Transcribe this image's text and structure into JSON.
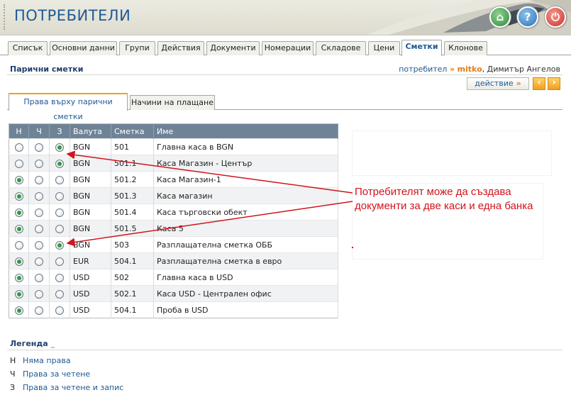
{
  "header": {
    "title": "ПОТРЕБИТЕЛИ"
  },
  "tabs": [
    {
      "label": "Списък"
    },
    {
      "label": "Основни данни"
    },
    {
      "label": "Групи"
    },
    {
      "label": "Действия"
    },
    {
      "label": "Документи"
    },
    {
      "label": "Номерации"
    },
    {
      "label": "Складове"
    },
    {
      "label": "Цени"
    },
    {
      "label": "Сметки",
      "active": true
    },
    {
      "label": "Клонове"
    }
  ],
  "section": {
    "title": "Парични сметки",
    "user_label": "потребител",
    "sep": "»",
    "username": "mitko",
    "fullname": ", Димитър Ангелов"
  },
  "actions": {
    "label": "действие",
    "arrow": "»",
    "prev": "‹",
    "next": "›"
  },
  "subtabs": [
    {
      "label": "Права върху парични сметки",
      "active": true
    },
    {
      "label": "Начини на плащане"
    }
  ],
  "table": {
    "columns": [
      "Н",
      "Ч",
      "З",
      "Валута",
      "Сметка",
      "Име"
    ],
    "rows": [
      {
        "sel": 2,
        "currency": "BGN",
        "account": "501",
        "name": "Главна каса в BGN"
      },
      {
        "sel": 2,
        "currency": "BGN",
        "account": "501.1",
        "name": "Каса Магазин - Център"
      },
      {
        "sel": 0,
        "currency": "BGN",
        "account": "501.2",
        "name": "Каса Магазин-1"
      },
      {
        "sel": 0,
        "currency": "BGN",
        "account": "501.3",
        "name": "Каса магазин"
      },
      {
        "sel": 0,
        "currency": "BGN",
        "account": "501.4",
        "name": "Каса търговски обект"
      },
      {
        "sel": 0,
        "currency": "BGN",
        "account": "501.5",
        "name": "Каса 5"
      },
      {
        "sel": 2,
        "currency": "BGN",
        "account": "503",
        "name": "Разплащателна сметка ОББ"
      },
      {
        "sel": 0,
        "currency": "EUR",
        "account": "504.1",
        "name": "Разплащателна сметка в евро"
      },
      {
        "sel": 0,
        "currency": "USD",
        "account": "502",
        "name": "Главна каса в USD"
      },
      {
        "sel": 0,
        "currency": "USD",
        "account": "502.1",
        "name": "Каса USD - Централен офис"
      },
      {
        "sel": 0,
        "currency": "USD",
        "account": "504.1",
        "name": "Проба в USD"
      }
    ]
  },
  "annotation": {
    "text": "Потребителят може да създава документи за две каси и една банка",
    "color": "#d0141c"
  },
  "legend": {
    "title": "Легенда",
    "mark": "_",
    "items": [
      {
        "key": "Н",
        "label": "Няма права"
      },
      {
        "key": "Ч",
        "label": "Права за четене"
      },
      {
        "key": "З",
        "label": "Права за четене и запис"
      }
    ]
  }
}
